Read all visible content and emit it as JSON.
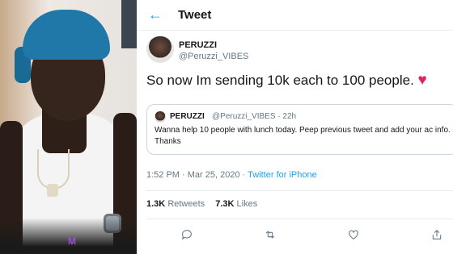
{
  "header": {
    "back_icon": "arrow-left-icon",
    "title": "Tweet"
  },
  "tweet": {
    "author_name": "PERUZZI",
    "author_handle": "@Peruzzi_VIBES",
    "text": "So now Im sending 10k each to 100 people.",
    "emoji": "♥",
    "timestamp": "1:52 PM · Mar 25, 2020 · ",
    "source": "Twitter for iPhone"
  },
  "quoted": {
    "author_name": "PERUZZI",
    "author_handle_time": "@Peruzzi_VIBES · 22h",
    "text": "Wanna help 10 people with lunch today. Peep previous tweet and add your ac info. Thanks"
  },
  "stats": {
    "retweets_count": "1.3K",
    "retweets_label": "Retweets",
    "likes_count": "7.3K",
    "likes_label": "Likes"
  },
  "actions": [
    "reply-icon",
    "retweet-icon",
    "like-icon",
    "share-icon"
  ],
  "photo": {
    "watermark": "M"
  },
  "colors": {
    "accent": "#1da1f2",
    "heart": "#e0245e",
    "muted": "#657786"
  }
}
